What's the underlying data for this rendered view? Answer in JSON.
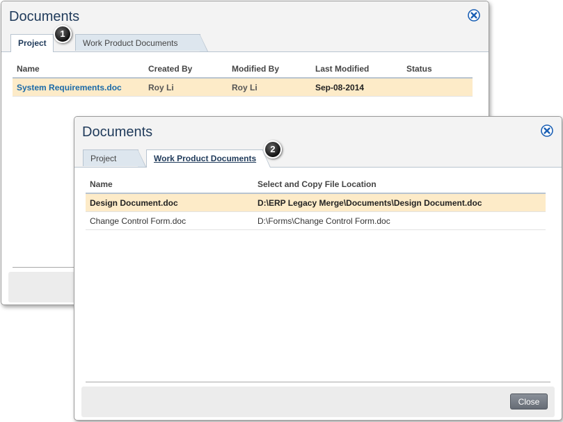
{
  "dialog1": {
    "title": "Documents",
    "tabs": {
      "project": "Project",
      "work_product": "Work Product Documents"
    },
    "callout": "1",
    "columns": [
      "Name",
      "Created By",
      "Modified By",
      "Last Modified",
      "Status"
    ],
    "rows": [
      {
        "name": "System Requirements.doc",
        "created_by": "Roy Li",
        "modified_by": "Roy Li",
        "last_modified": "Sep-08-2014",
        "status": ""
      }
    ]
  },
  "dialog2": {
    "title": "Documents",
    "tabs": {
      "project": "Project",
      "work_product": "Work Product Documents"
    },
    "callout": "2",
    "columns": [
      "Name",
      "Select and Copy File Location"
    ],
    "rows": [
      {
        "name": "Design Document.doc",
        "location": "D:\\ERP Legacy Merge\\Documents\\Design Document.doc"
      },
      {
        "name": "Change Control Form.doc",
        "location": "D:\\Forms\\Change Control Form.doc"
      }
    ],
    "close_label": "Close"
  },
  "icons": {
    "close": "close-circle-x-icon"
  },
  "colors": {
    "title": "#1f3a5a",
    "link": "#1a6aa8",
    "selected_row": "#fdebc8",
    "tab_inactive": "#dde6ee"
  }
}
